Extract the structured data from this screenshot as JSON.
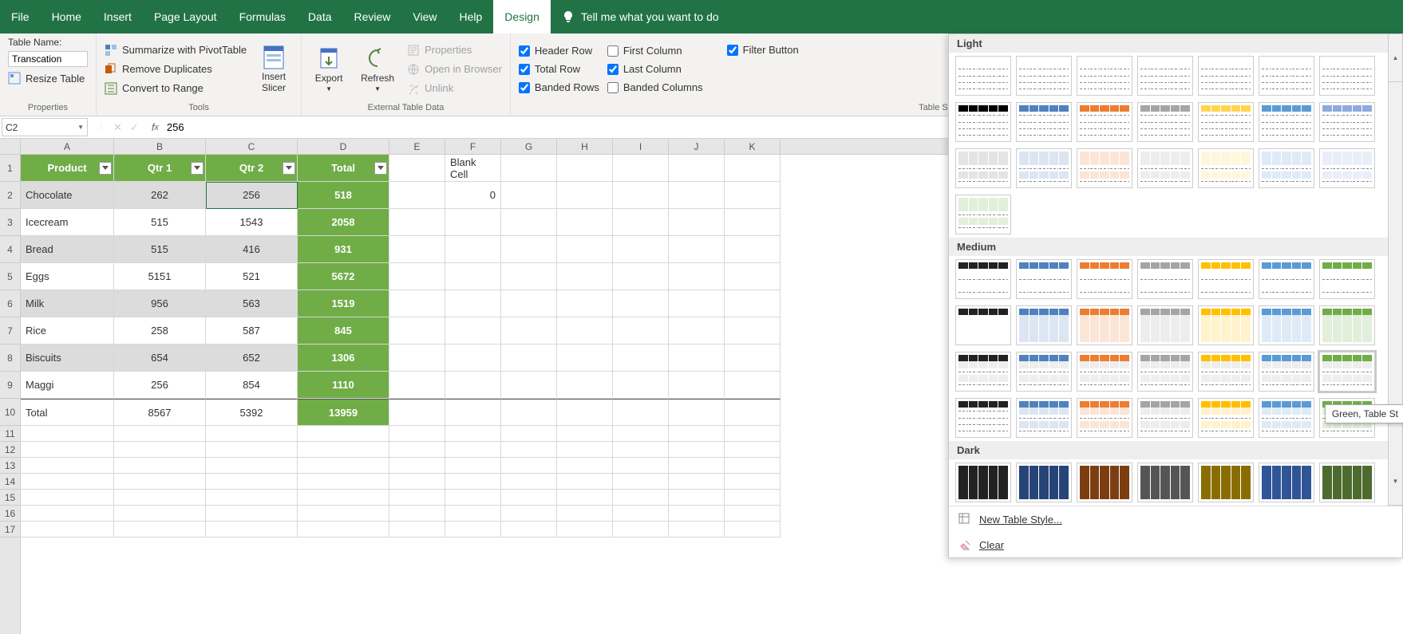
{
  "menu": {
    "tabs": [
      "File",
      "Home",
      "Insert",
      "Page Layout",
      "Formulas",
      "Data",
      "Review",
      "View",
      "Help",
      "Design"
    ],
    "active": "Design",
    "tell_me": "Tell me what you want to do"
  },
  "ribbon": {
    "properties": {
      "table_name_label": "Table Name:",
      "table_name_value": "Transcation",
      "resize": "Resize Table",
      "group": "Properties"
    },
    "tools": {
      "pivot": "Summarize with PivotTable",
      "dup": "Remove Duplicates",
      "range": "Convert to Range",
      "slicer": "Insert\nSlicer",
      "group": "Tools"
    },
    "external": {
      "export": "Export",
      "refresh": "Refresh",
      "props": "Properties",
      "browser": "Open in Browser",
      "unlink": "Unlink",
      "group": "External Table Data"
    },
    "options": {
      "header": "Header Row",
      "total": "Total Row",
      "banded_rows": "Banded Rows",
      "first_col": "First Column",
      "last_col": "Last Column",
      "banded_cols": "Banded Columns",
      "filter": "Filter Button",
      "group": "Table Style Options"
    }
  },
  "formula": {
    "cell_ref": "C2",
    "value": "256"
  },
  "columns": [
    "A",
    "B",
    "C",
    "D",
    "E",
    "F",
    "G",
    "H",
    "I",
    "J",
    "K"
  ],
  "table": {
    "headers": [
      "Product",
      "Qtr 1",
      "Qtr 2",
      "Total"
    ],
    "rows": [
      {
        "p": "Chocolate",
        "q1": "262",
        "q2": "256",
        "t": "518"
      },
      {
        "p": "Icecream",
        "q1": "515",
        "q2": "1543",
        "t": "2058"
      },
      {
        "p": "Bread",
        "q1": "515",
        "q2": "416",
        "t": "931"
      },
      {
        "p": "Eggs",
        "q1": "5151",
        "q2": "521",
        "t": "5672"
      },
      {
        "p": "Milk",
        "q1": "956",
        "q2": "563",
        "t": "1519"
      },
      {
        "p": "Rice",
        "q1": "258",
        "q2": "587",
        "t": "845"
      },
      {
        "p": "Biscuits",
        "q1": "654",
        "q2": "652",
        "t": "1306"
      },
      {
        "p": "Maggi",
        "q1": "256",
        "q2": "854",
        "t": "1110"
      }
    ],
    "total": {
      "label": "Total",
      "q1": "8567",
      "q2": "5392",
      "t": "13959"
    }
  },
  "extra": {
    "blank_label": "Blank Cell",
    "blank_value": "0"
  },
  "gallery": {
    "light": "Light",
    "medium": "Medium",
    "dark": "Dark",
    "new_style": "New Table Style...",
    "clear": "Clear",
    "tooltip": "Green, Table St",
    "light_colors": [
      "#7a7a7a",
      "#4f81bd",
      "#ed7d31",
      "#a5a5a5",
      "#ffd54f",
      "#5b9bd5",
      "#8faadc"
    ],
    "medium_colors": [
      "#222",
      "#4f81bd",
      "#ed7d31",
      "#a5a5a5",
      "#ffc000",
      "#5b9bd5",
      "#70ad47"
    ],
    "dark_colors": [
      "#222",
      "#264478",
      "#7c3e11",
      "#555",
      "#8a6d00",
      "#2f5597",
      "#4d6b2f"
    ]
  }
}
